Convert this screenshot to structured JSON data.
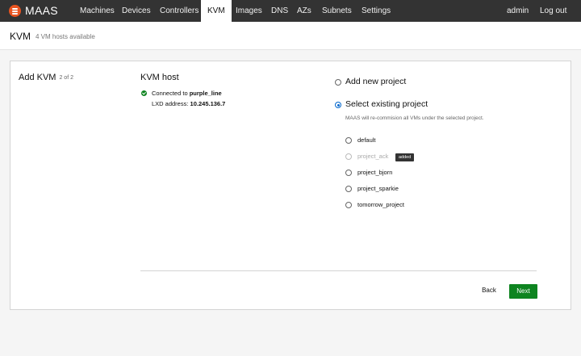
{
  "nav": {
    "brand": "MAAS",
    "items": [
      "Machines",
      "Devices",
      "Controllers",
      "KVM",
      "Images",
      "DNS",
      "AZs",
      "Subnets",
      "Settings"
    ],
    "active": "KVM",
    "user": "admin",
    "logout": "Log out"
  },
  "header": {
    "title": "KVM",
    "subtitle": "4 VM hosts available"
  },
  "form": {
    "title": "Add KVM",
    "step": "2 of 2",
    "section_title": "KVM host",
    "connected_prefix": "Connected to",
    "connected_host": "purple_line",
    "lxd_prefix": "LXD address:",
    "lxd_address": "10.245.136.7",
    "option_new": "Add new project",
    "option_existing": "Select existing project",
    "selected_option": "Select existing project",
    "help_text": "MAAS will re-commision all VMs under the selected project.",
    "projects": [
      {
        "name": "default",
        "disabled": false
      },
      {
        "name": "project_ack",
        "disabled": true,
        "badge": "added"
      },
      {
        "name": "project_bjorn",
        "disabled": false
      },
      {
        "name": "project_sparkie",
        "disabled": false
      },
      {
        "name": "tomorrow_project",
        "disabled": false
      }
    ],
    "back_label": "Back",
    "next_label": "Next"
  },
  "colors": {
    "navbar": "#333333",
    "brand_logo": "#e95420",
    "success": "#0e8420",
    "radio_selected": "#0066cc"
  }
}
